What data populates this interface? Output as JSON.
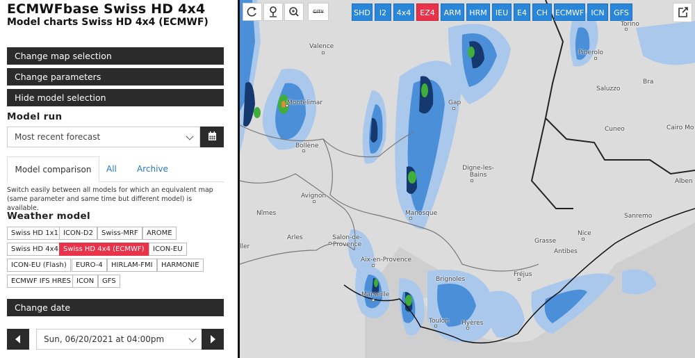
{
  "header": {
    "title": "ECMWFbase Swiss HD 4x4",
    "subtitle": "Model charts Swiss HD 4x4 (ECMWF)"
  },
  "sidebar": {
    "change_map_label": "Change map selection",
    "change_params_label": "Change parameters",
    "hide_model_label": "Hide model selection",
    "model_run_heading": "Model run",
    "model_run_value": "Most recent forecast",
    "tabs": [
      {
        "label": "Model comparison"
      },
      {
        "label": "All"
      },
      {
        "label": "Archive"
      }
    ],
    "description": "Switch easily between all models for which an equivalent map (same parameter and same time but different model) is available.",
    "weather_model_heading": "Weather model",
    "models_row1": [
      "Swiss HD 1x1",
      "ICON-D2",
      "Swiss-MRF",
      "AROME"
    ],
    "models_row2": [
      "Swiss HD 4x4",
      "Swiss HD 4x4 (ECMWF)",
      "ICON-EU"
    ],
    "models_row3": [
      "ICON-EU (Flash)",
      "EURO-4",
      "HIRLAM-FMI",
      "HARMONIE"
    ],
    "models_row4": [
      "ECMWF IFS HRES",
      "ICON",
      "GFS"
    ],
    "selected_model": "Swiss HD 4x4 (ECMWF)",
    "change_date_label": "Change date",
    "date_value": "Sun, 06/20/2021 at 04:00pm"
  },
  "map": {
    "tool_city_label": "CITY",
    "model_tabs": [
      "SHD",
      "I2",
      "4x4",
      "EZ4",
      "ARM",
      "HRM",
      "IEU",
      "E4",
      "CH",
      "ECMWF",
      "ICN",
      "GFS"
    ],
    "active_model_tab": "EZ4",
    "cities": [
      "Torino",
      "Valence",
      "Pinerolo",
      "Bra",
      "Saluzzo",
      "Montélimar",
      "Gap",
      "Cuneo",
      "Cairo Mo",
      "Bollène",
      "Digne-les-Bains",
      "Alben",
      "Avignon",
      "Nîmes",
      "Manosque",
      "Sanremo",
      "Arles",
      "Salon-de-Provence",
      "Nice",
      "Grasse",
      "Antibes",
      "Aix-en-Provence",
      "Brignoles",
      "Fréjus",
      "Marseille",
      "Toulon",
      "Hyères",
      "ller"
    ],
    "colors": {
      "precip_light": "#a9c8ec",
      "precip_mid": "#4a8fd8",
      "precip_dark": "#15386e",
      "precip_green": "#3fae3a",
      "active_tab": "#e8334a",
      "tab": "#2a86d8"
    }
  }
}
